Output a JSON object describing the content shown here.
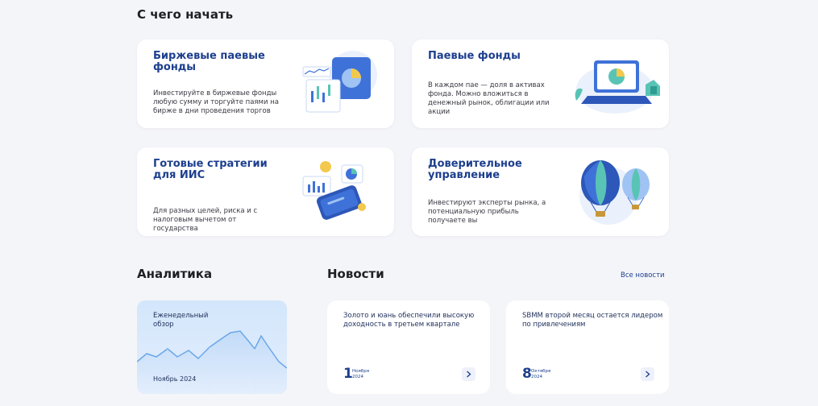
{
  "start": {
    "title": "С чего начать",
    "cards": [
      {
        "title": "Биржевые паевые фонды",
        "description": "Инвестируйте в биржевые фонды любую сумму и торгуйте паями на бирже в дни проведения торгов",
        "icon": "chart-tablet-illustration"
      },
      {
        "title": "Паевые фонды",
        "description": "В каждом пае — доля в активах фонда. Можно вложиться в денежный рынок, облигации или акции",
        "icon": "laptop-pie-illustration"
      },
      {
        "title": "Готовые стратегии для ИИС",
        "description": "Для разных целей, риска и с налоговым вычетом от государства",
        "icon": "phone-coins-illustration"
      },
      {
        "title": "Доверительное управление",
        "description": "Инвестируют эксперты рынка, а потенциальную прибыль получаете вы",
        "icon": "hot-air-balloons-illustration"
      }
    ]
  },
  "analytics": {
    "title": "Аналитика",
    "card": {
      "title": "Еженедельный обзор",
      "date": "Ноябрь 2024"
    }
  },
  "news": {
    "title": "Новости",
    "all_link": "Все новости",
    "items": [
      {
        "title": "Золото и юань обеспечили высокую доходность в третьем квартале",
        "day": "1",
        "month": "Ноября",
        "year": "2024"
      },
      {
        "title": "SBMM второй месяц остается лидером по привлечениям",
        "day": "8",
        "month": "Октября",
        "year": "2024"
      }
    ]
  },
  "colors": {
    "accent": "#1d3f8e",
    "background": "#f4f5f9",
    "card": "#ffffff"
  }
}
